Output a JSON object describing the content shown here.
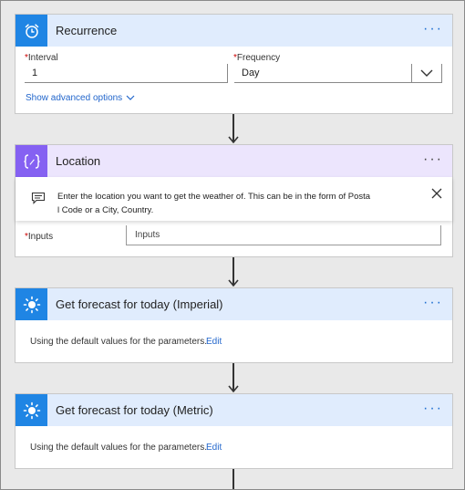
{
  "recurrence": {
    "title": "Recurrence",
    "interval_label": "Interval",
    "interval_value": "1",
    "frequency_label": "Frequency",
    "frequency_value": "Day",
    "advanced_link": "Show advanced options",
    "header_color": "#e0ecfd",
    "icon_color": "#1f85e4",
    "icon": "alarm-clock-icon"
  },
  "location": {
    "title": "Location",
    "description_line1": "Enter the location you want to get the weather of. This can be in the form of Posta",
    "description_line2": "l Code or a City, Country.",
    "inputs_label": "Inputs",
    "inputs_placeholder": "Inputs",
    "header_color": "#ece5fd",
    "icon_color": "#8561f2",
    "icon": "curly-brace-icon"
  },
  "forecast_imperial": {
    "title": "Get forecast for today (Imperial)",
    "description": "Using the default values for the parameters.",
    "edit_link": "Edit",
    "header_color": "#e0ecfd",
    "icon_color": "#1f85e4",
    "icon": "sun-icon"
  },
  "forecast_metric": {
    "title": "Get forecast for today (Metric)",
    "description": "Using the default values for the parameters.",
    "edit_link": "Edit",
    "header_color": "#e0ecfd",
    "icon_color": "#1f85e4",
    "icon": "sun-icon"
  },
  "more_menu_glyph": "···"
}
